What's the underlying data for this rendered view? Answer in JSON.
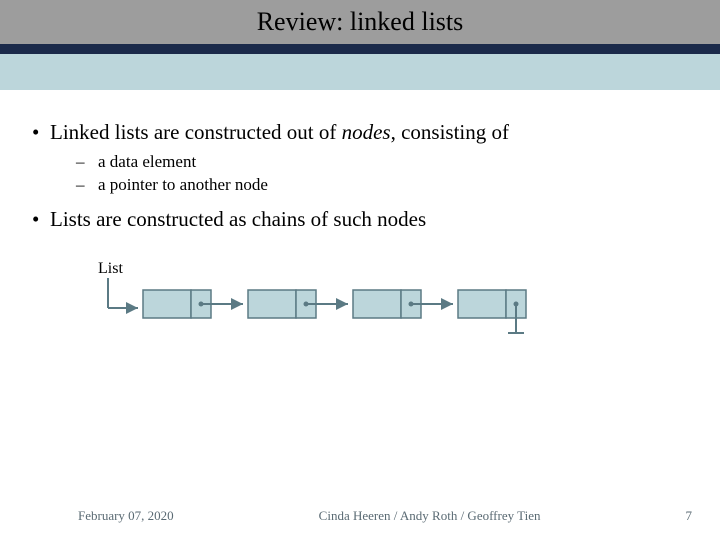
{
  "title": "Review: linked lists",
  "bullets": [
    {
      "text_before": "Linked lists are constructed out of ",
      "italic": "nodes",
      "text_after": ", consisting of",
      "sub": [
        "a data element",
        "a pointer to another node"
      ]
    },
    {
      "text_before": "Lists are constructed as chains of such nodes",
      "italic": "",
      "text_after": "",
      "sub": []
    }
  ],
  "diagram_label": "List",
  "footer": {
    "date": "February 07, 2020",
    "authors": "Cinda Heeren / Andy Roth / Geoffrey Tien",
    "page": "7"
  },
  "colors": {
    "node_fill": "#bcd6db",
    "node_stroke": "#5b7a84",
    "arrow": "#5b7a84"
  }
}
